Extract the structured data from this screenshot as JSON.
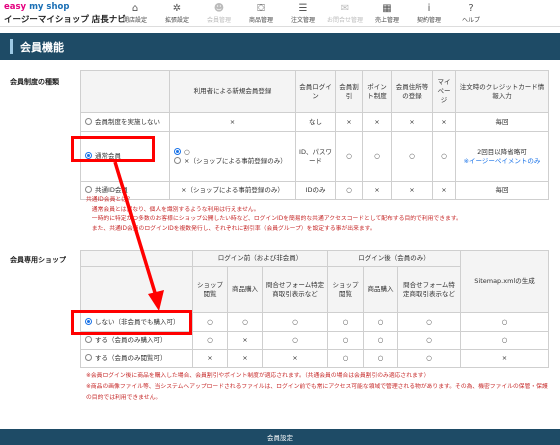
{
  "brand": {
    "logo_prefix": "easy",
    "logo_suffix": "my shop",
    "shop_name": "イージーマイショップ 店長ナビ"
  },
  "nav": [
    {
      "icon": "⌂",
      "label": "開店設定",
      "dim": false
    },
    {
      "icon": "✲",
      "label": "拡張設定",
      "dim": false
    },
    {
      "icon": "☻",
      "label": "会員管理",
      "dim": true
    },
    {
      "icon": "⛋",
      "label": "商品管理",
      "dim": false
    },
    {
      "icon": "☰",
      "label": "注文管理",
      "dim": false
    },
    {
      "icon": "✉",
      "label": "お問合せ管理",
      "dim": true
    },
    {
      "icon": "▦",
      "label": "売上管理",
      "dim": false
    },
    {
      "icon": "i",
      "label": "契約管理",
      "dim": false
    },
    {
      "icon": "?",
      "label": "ヘルプ",
      "dim": false
    }
  ],
  "page_title": "会員機能",
  "membership": {
    "label": "会員制度の種類",
    "headers": [
      "利用者による新規会員登録",
      "会員ログイン",
      "会員割引",
      "ポイント制度",
      "会員住所等の登録",
      "マイページ",
      "注文時のクレジットカード情報入力"
    ],
    "rows": [
      {
        "label": "会員制度を実施しない",
        "selected": false,
        "reg": "×",
        "login": "なし",
        "discount": "×",
        "points": "×",
        "address": "×",
        "mypage": "×",
        "credit": "毎回"
      },
      {
        "label": "通常会員",
        "selected": true,
        "reg_opt1": "○",
        "reg_opt2": "×（ショップによる事前登録のみ）",
        "login": "ID、パスワード",
        "discount": "○",
        "points": "○",
        "address": "○",
        "mypage": "○",
        "credit": "2回目以降省略可",
        "credit_link": "※イージーペイメントのみ"
      },
      {
        "label": "共通ID会員",
        "selected": false,
        "reg": "×（ショップによる事前登録のみ）",
        "login": "IDのみ",
        "discount": "○",
        "points": "×",
        "address": "×",
        "mypage": "×",
        "credit": "毎回"
      }
    ],
    "notes": [
      "共通ID会員とは？",
      "　通常会員とは異なり、個人を識別するような利用は行えません。",
      "　一時的に特定かつ多数のお客様にショップ公開したい時など、ログインIDを簡易的な共通アクセスコードとして配布する目的で利用できます。",
      "　また、共通ID会員のログインIDを複数発行し、それぞれに割引率（会員グループ）を設定する事が出来ます。"
    ]
  },
  "members_shop": {
    "label": "会員専用ショップ",
    "group_before": "ログイン前（および非会員）",
    "group_after": "ログイン後（会員のみ）",
    "sub_headers": [
      "ショップ閲覧",
      "商品購入",
      "問合せフォーム特定商取引表示など",
      "ショップ閲覧",
      "商品購入",
      "問合せフォーム特定商取引表示など"
    ],
    "sitemap_header": "Sitemap.xmlの生成",
    "rows": [
      {
        "label": "しない（非会員でも購入可）",
        "selected": true,
        "cells": [
          "○",
          "○",
          "○",
          "○",
          "○",
          "○"
        ],
        "sitemap": "○"
      },
      {
        "label": "する（会員のみ購入可）",
        "selected": false,
        "cells": [
          "○",
          "×",
          "○",
          "○",
          "○",
          "○"
        ],
        "sitemap": "○"
      },
      {
        "label": "する（会員のみ閲覧可）",
        "selected": false,
        "cells": [
          "×",
          "×",
          "×",
          "○",
          "○",
          "○"
        ],
        "sitemap": "×"
      }
    ],
    "notes": [
      "※会員ログイン後に商品を購入した場合、会員割引やポイント制度が適応されます。（共通会員の場合は会員割引のみ適応されます）",
      "※商品の画像ファイル等、当システムへアップロードされるファイルは、ログイン前でも常にアクセス可能な領域で管理される物があります。その為、機密ファイルの保管・保護の目的では利用できません。"
    ]
  },
  "footer": {
    "button_label": "会員設定"
  },
  "accent_colors": {
    "header_bg": "#1e4b66",
    "highlight": "#ff0000",
    "link": "#1a73e8",
    "note": "#c62828"
  }
}
